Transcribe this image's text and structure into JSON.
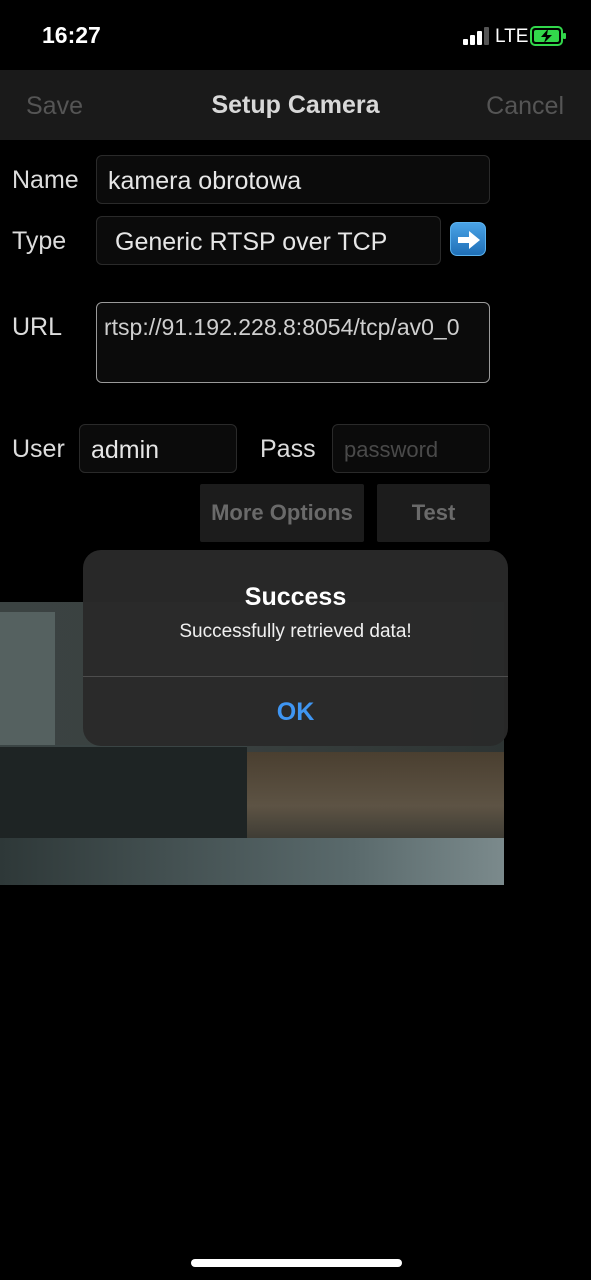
{
  "status": {
    "time": "16:27",
    "network": "LTE"
  },
  "nav": {
    "save": "Save",
    "title": "Setup Camera",
    "cancel": "Cancel"
  },
  "form": {
    "name_label": "Name",
    "name_value": "kamera obrotowa",
    "type_label": "Type",
    "type_value": "Generic RTSP over TCP",
    "url_label": "URL",
    "url_value": "rtsp://91.192.228.8:8054/tcp/av0_0",
    "user_label": "User",
    "user_value": "admin",
    "pass_label": "Pass",
    "pass_placeholder": "password",
    "more_options": "More Options",
    "test": "Test"
  },
  "camera": {
    "timestamp": ""
  },
  "alert": {
    "title": "Success",
    "message": "Successfully retrieved data!",
    "ok": "OK"
  },
  "colors": {
    "accent": "#3f96f3",
    "battery": "#32d74b",
    "arrow_button": "#2e86d4"
  }
}
